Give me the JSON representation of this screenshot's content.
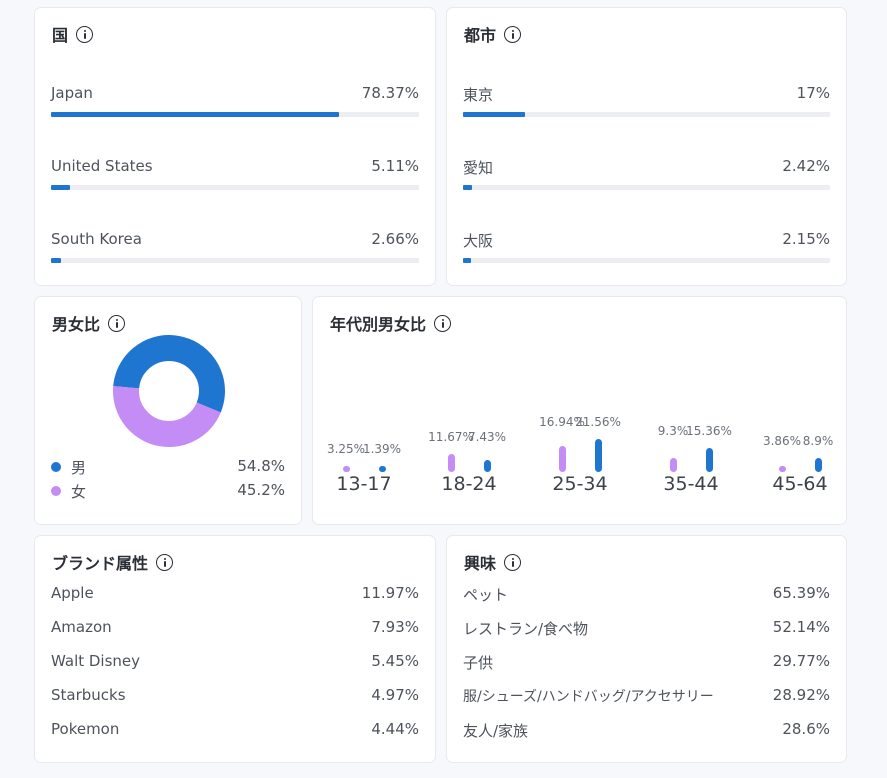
{
  "countries": {
    "title": "国",
    "items": [
      {
        "label": "Japan",
        "value": "78.37%",
        "pct": 78.37
      },
      {
        "label": "United States",
        "value": "5.11%",
        "pct": 5.11
      },
      {
        "label": "South Korea",
        "value": "2.66%",
        "pct": 2.66
      }
    ]
  },
  "cities": {
    "title": "都市",
    "items": [
      {
        "label": "東京",
        "value": "17%",
        "pct": 17
      },
      {
        "label": "愛知",
        "value": "2.42%",
        "pct": 2.42
      },
      {
        "label": "大阪",
        "value": "2.15%",
        "pct": 2.15
      }
    ]
  },
  "gender": {
    "title": "男女比",
    "items": [
      {
        "label": "男",
        "value": "54.8%",
        "pct": 54.8,
        "color": "#1f76d1"
      },
      {
        "label": "女",
        "value": "45.2%",
        "pct": 45.2,
        "color": "#c48cf5"
      }
    ]
  },
  "age_gender": {
    "title": "年代別男女比",
    "female_color": "#c48cf5",
    "male_color": "#1f76d1",
    "groups": [
      {
        "label": "13-17",
        "female": "3.25%",
        "male": "1.39%",
        "female_pct": 3.25,
        "male_pct": 1.39
      },
      {
        "label": "18-24",
        "female": "11.67%",
        "male": "7.43%",
        "female_pct": 11.67,
        "male_pct": 7.43
      },
      {
        "label": "25-34",
        "female": "16.94%",
        "male": "21.56%",
        "female_pct": 16.94,
        "male_pct": 21.56
      },
      {
        "label": "35-44",
        "female": "9.3%",
        "male": "15.36%",
        "female_pct": 9.3,
        "male_pct": 15.36
      },
      {
        "label": "45-64",
        "female": "3.86%",
        "male": "8.9%",
        "female_pct": 3.86,
        "male_pct": 8.9
      }
    ]
  },
  "brands": {
    "title": "ブランド属性",
    "items": [
      {
        "label": "Apple",
        "value": "11.97%"
      },
      {
        "label": "Amazon",
        "value": "7.93%"
      },
      {
        "label": "Walt Disney",
        "value": "5.45%"
      },
      {
        "label": "Starbucks",
        "value": "4.97%"
      },
      {
        "label": "Pokemon",
        "value": "4.44%"
      }
    ]
  },
  "interests": {
    "title": "興味",
    "items": [
      {
        "label": "ペット",
        "value": "65.39%"
      },
      {
        "label": "レストラン/食べ物",
        "value": "52.14%"
      },
      {
        "label": "子供",
        "value": "29.77%"
      },
      {
        "label": "服/シューズ/ハンドバッグ/アクセサリー",
        "value": "28.92%"
      },
      {
        "label": "友人/家族",
        "value": "28.6%"
      }
    ]
  }
}
